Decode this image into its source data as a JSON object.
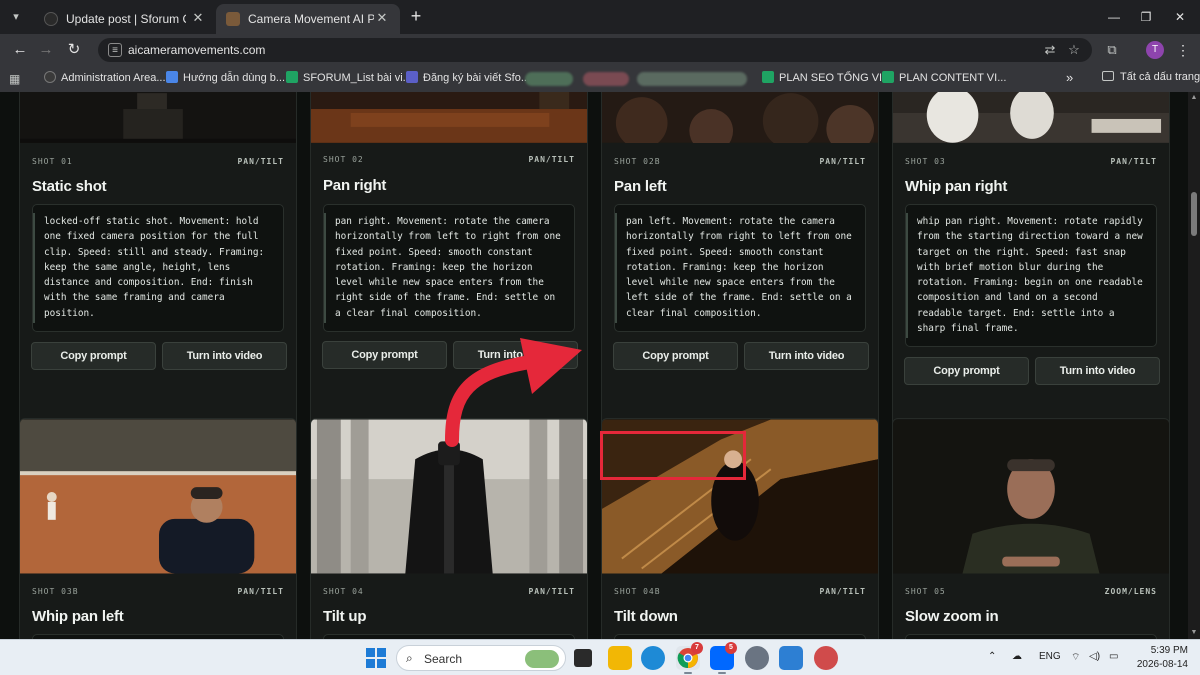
{
  "browser": {
    "tabs": [
      {
        "title": "Update post | Sforum CMS",
        "active": false
      },
      {
        "title": "Camera Movement AI Prompts",
        "active": true
      }
    ],
    "url": "aicameramovements.com",
    "profile_initial": "T",
    "bookmarks": [
      {
        "label": "Administration Area..."
      },
      {
        "label": "Hướng dẫn dùng b..."
      },
      {
        "label": "SFORUM_List bài vi..."
      },
      {
        "label": "Đăng ký bài viết Sfo..."
      },
      {
        "label": "PLAN SEO TỔNG VI..."
      },
      {
        "label": "PLAN CONTENT VI..."
      }
    ],
    "more_label": "»",
    "all_bookmarks_label": "Tất cả dấu trang"
  },
  "cards": [
    {
      "shot": "SHOT 01",
      "tag": "PAN/TILT",
      "title": "Static shot",
      "prompt": "locked-off static shot. Movement: hold one fixed camera position for the full clip. Speed: still and steady. Framing: keep the same angle, height, lens distance and composition. End: finish with the same framing and camera position.",
      "copy_label": "Copy prompt",
      "video_label": "Turn into video"
    },
    {
      "shot": "SHOT 02",
      "tag": "PAN/TILT",
      "title": "Pan right",
      "prompt": "pan right. Movement: rotate the camera horizontally from left to right from one fixed point. Speed: smooth constant rotation. Framing: keep the horizon level while new space enters from the right side of the frame. End: settle on a clear final composition.",
      "copy_label": "Copy prompt",
      "video_label": "Turn into video"
    },
    {
      "shot": "SHOT 02B",
      "tag": "PAN/TILT",
      "title": "Pan left",
      "prompt": "pan left. Movement: rotate the camera horizontally from right to left from one fixed point. Speed: smooth constant rotation. Framing: keep the horizon level while new space enters from the left side of the frame. End: settle on a clear final composition.",
      "copy_label": "Copy prompt",
      "video_label": "Turn into video"
    },
    {
      "shot": "SHOT 03",
      "tag": "PAN/TILT",
      "title": "Whip pan right",
      "prompt": "whip pan right. Movement: rotate rapidly from the starting direction toward a new target on the right. Speed: fast snap with brief motion blur during the rotation. Framing: begin on one readable composition and land on a second readable target. End: settle into a sharp final frame.",
      "copy_label": "Copy prompt",
      "video_label": "Turn into video"
    },
    {
      "shot": "SHOT 03B",
      "tag": "PAN/TILT",
      "title": "Whip pan left"
    },
    {
      "shot": "SHOT 04",
      "tag": "PAN/TILT",
      "title": "Tilt up"
    },
    {
      "shot": "SHOT 04B",
      "tag": "PAN/TILT",
      "title": "Tilt down"
    },
    {
      "shot": "SHOT 05",
      "tag": "ZOOM/LENS",
      "title": "Slow zoom in"
    }
  ],
  "annotation": {
    "highlight_color": "#e5283a"
  },
  "taskbar": {
    "search_label": "Search",
    "language": "ENG",
    "time": "5:39 PM",
    "date": "2026-08-14",
    "chrome_badge": "7",
    "zalo_badge": "5"
  }
}
